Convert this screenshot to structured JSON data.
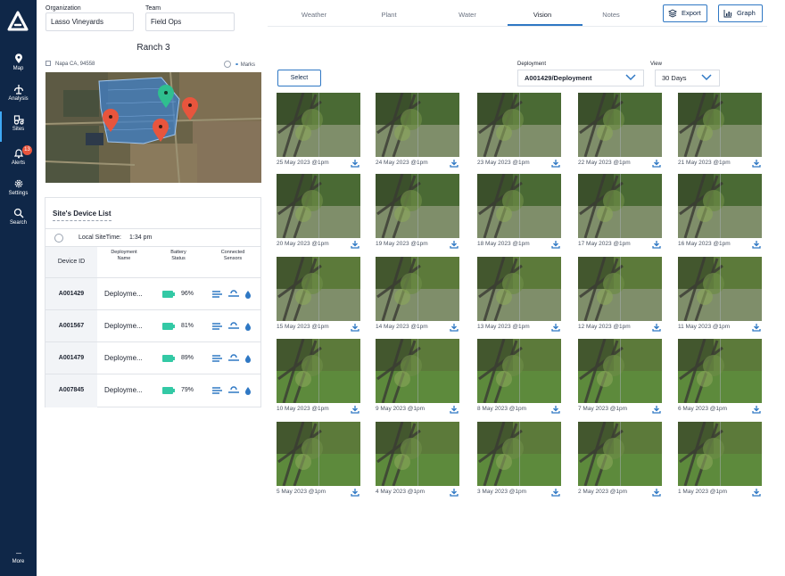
{
  "sidebar": {
    "items": [
      {
        "label": "Map",
        "icon": "pin-icon"
      },
      {
        "label": "Analysis",
        "icon": "analysis-icon"
      },
      {
        "label": "Sites",
        "icon": "tractor-icon"
      },
      {
        "label": "Alerts",
        "icon": "bell-icon",
        "badge": "13"
      },
      {
        "label": "Settings",
        "icon": "gear-icon"
      },
      {
        "label": "Search",
        "icon": "search-icon"
      }
    ],
    "more_label": "More",
    "active": "Sites"
  },
  "org": {
    "label": "Organization",
    "value": "Lasso Vineyards"
  },
  "team": {
    "label": "Team",
    "value": "Field Ops"
  },
  "site": {
    "title": "Ranch 3",
    "address": "Napa CA, 94558",
    "marks_label": "Marks"
  },
  "device_list": {
    "title": "Site's Device List",
    "local_time_label": "Local SiteTime:",
    "local_time_value": "1:34 pm",
    "headers": {
      "id": "Device ID",
      "name_1": "Deployment",
      "name_2": "Name",
      "battery_1": "Battery",
      "battery_2": "Status",
      "sensors_1": "Connected",
      "sensors_2": "Sensors"
    },
    "rows": [
      {
        "id": "A001429",
        "name": "Deployme...",
        "battery": "96%"
      },
      {
        "id": "A001567",
        "name": "Deployme...",
        "battery": "81%"
      },
      {
        "id": "A001479",
        "name": "Deployme...",
        "battery": "89%"
      },
      {
        "id": "A007845",
        "name": "Deployme...",
        "battery": "79%"
      }
    ]
  },
  "tabs": [
    {
      "label": "Weather"
    },
    {
      "label": "Plant"
    },
    {
      "label": "Water"
    },
    {
      "label": "Vision",
      "active": true
    },
    {
      "label": "Notes"
    }
  ],
  "actions": {
    "export_label": "Export",
    "graph_label": "Graph"
  },
  "gallery_controls": {
    "select_label": "Select",
    "deployment_label": "Deployment",
    "deployment_value": "A001429/Deployment",
    "view_label": "View",
    "view_value": "30 Days"
  },
  "gallery": [
    "25 May 2023 @1pm",
    "24 May 2023 @1pm",
    "23 May 2023 @1pm",
    "22 May 2023 @1pm",
    "21 May 2023 @1pm",
    "20 May 2023 @1pm",
    "19 May 2023 @1pm",
    "18 May 2023 @1pm",
    "17 May 2023 @1pm",
    "16 May 2023 @1pm",
    "15 May 2023 @1pm",
    "14 May 2023 @1pm",
    "13 May 2023 @1pm",
    "12 May 2023 @1pm",
    "11 May 2023 @1pm",
    "10 May 2023 @1pm",
    "9 May 2023 @1pm",
    "8 May 2023 @1pm",
    "7 May 2023 @1pm",
    "6 May 2023 @1pm",
    "5 May 2023 @1pm",
    "4 May 2023 @1pm",
    "3 May 2023 @1pm",
    "2 May 2023 @1pm",
    "1 May 2023 @1pm"
  ],
  "colors": {
    "sidebar": "#0f2748",
    "accent": "#2f78c4",
    "battery": "#33c9a5",
    "pin_red": "#e8553d",
    "pin_green": "#2fbf8f"
  }
}
